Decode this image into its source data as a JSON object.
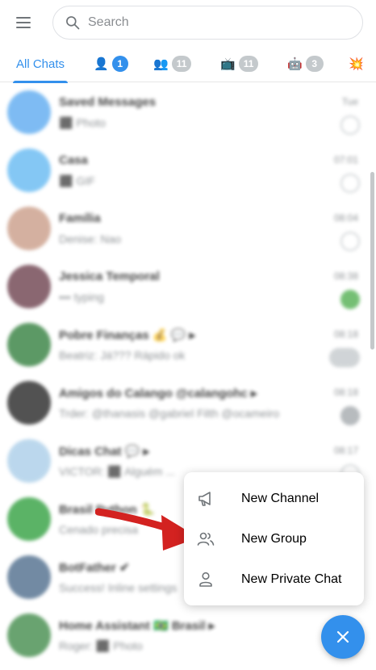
{
  "search": {
    "placeholder": "Search"
  },
  "tabs": [
    {
      "label": "All Chats",
      "active": true
    },
    {
      "emoji": "👤",
      "badge": "1",
      "badge_active": true
    },
    {
      "emoji": "👥",
      "badge": "11"
    },
    {
      "emoji": "📺",
      "badge": "11"
    },
    {
      "emoji": "🤖",
      "badge": "3"
    },
    {
      "emoji": "💥"
    }
  ],
  "chats": [
    {
      "title": "Saved Messages",
      "message": "⬛ Photo",
      "time": "Tue",
      "avatar_color": "#5aa9f0"
    },
    {
      "title": "Casa",
      "message": "⬛ GIF",
      "time": "07:01",
      "avatar_color": "#62b8f2"
    },
    {
      "title": "Família",
      "message": "Denise: Nao",
      "time": "08:04",
      "avatar_color": "#c99b86"
    },
    {
      "title": "Jessica Temporal",
      "message": "••• typing",
      "time": "08:38",
      "avatar_color": "#6a3d4a"
    },
    {
      "title": "Pobre Finanças 💰 💬 ▸",
      "message": "Beatriz: Já??? Rápido ok",
      "time": "08:18",
      "avatar_color": "#2f7d3a"
    },
    {
      "title": "Amigos do Calango @calangohc ▸",
      "message": "Trder: @thanasis @gabriel Filth @ocameiro",
      "time": "08:18",
      "avatar_color": "#222222"
    },
    {
      "title": "Dicas Chat 💬 ▸",
      "message": "VICTOR: ⬛ Alguém ...",
      "time": "08:17",
      "avatar_color": "#a9cde8"
    },
    {
      "title": "Brasil Python 🐍",
      "message": "Cenado precisa",
      "time": "",
      "avatar_color": "#2e9e3c"
    },
    {
      "title": "BotFather ✔",
      "message": "Success! Inline settings",
      "time": "",
      "avatar_color": "#4b6a8a"
    },
    {
      "title": "Home Assistant 🇧🇷 Brasil ▸",
      "message": "Roger: ⬛ Photo",
      "time": "",
      "avatar_color": "#3f8a48"
    }
  ],
  "popup_menu": {
    "items": [
      {
        "label": "New Channel",
        "icon": "megaphone-icon"
      },
      {
        "label": "New Group",
        "icon": "group-icon"
      },
      {
        "label": "New Private Chat",
        "icon": "user-icon"
      }
    ]
  },
  "colors": {
    "accent": "#3390ec",
    "annotation_arrow": "#d32220"
  }
}
